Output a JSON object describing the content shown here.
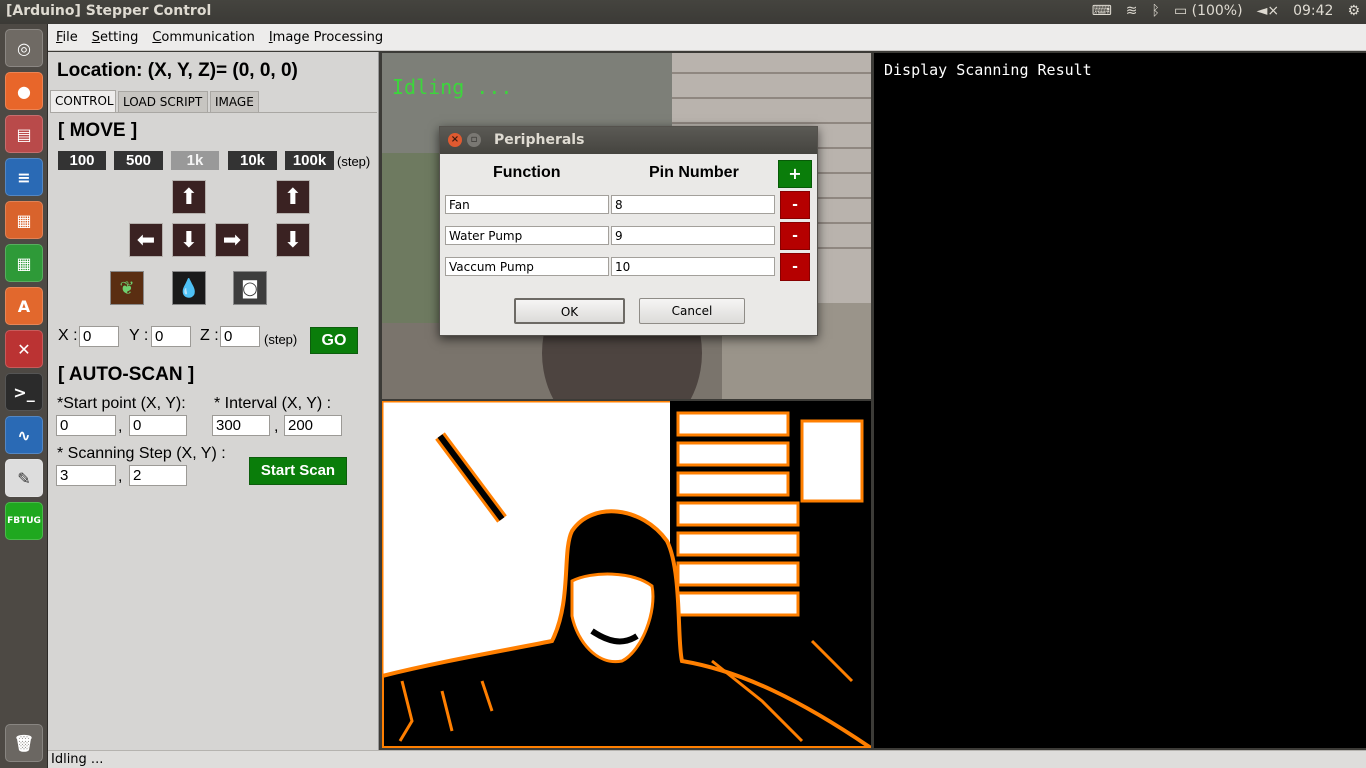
{
  "window": {
    "title": "[Arduino] Stepper Control"
  },
  "tray": {
    "battery": "(100%)",
    "time": "09:42"
  },
  "launcher": {
    "fbtug_label": "FBTUG"
  },
  "menu": [
    "File",
    "Setting",
    "Communication",
    "Image Processing"
  ],
  "location_text": "Location: (X, Y, Z)= (0, 0, 0)",
  "tabs": [
    "CONTROL",
    "LOAD SCRIPT",
    "IMAGE"
  ],
  "move": {
    "header": "[ MOVE ]",
    "steps": [
      "100",
      "500",
      "1k",
      "10k",
      "100k"
    ],
    "selected_step": "1k",
    "step_unit": "(step)"
  },
  "goto": {
    "x_label": "X :",
    "x_value": "0",
    "y_label": "Y :",
    "y_value": "0",
    "z_label": "Z :",
    "z_value": "0",
    "unit": "(step)",
    "go_label": "GO"
  },
  "autoscan": {
    "header": "[ AUTO-SCAN ]",
    "start_label": "*Start point (X, Y):",
    "start_x": "0",
    "start_y": "0",
    "interval_label": "* Interval (X, Y) :",
    "interval_x": "300",
    "interval_y": "200",
    "step_label": "* Scanning Step (X, Y) :",
    "step_x": "3",
    "step_y": "2",
    "comma": ",",
    "start_scan_label": "Start Scan"
  },
  "camera": {
    "overlay_text": "Idling ..."
  },
  "result": {
    "title": "Display Scanning Result"
  },
  "status": "Idling ...",
  "dialog": {
    "title": "Peripherals",
    "col_function": "Function",
    "col_pin": "Pin Number",
    "add_label": "+",
    "remove_label": "-",
    "rows": [
      {
        "function": "Fan",
        "pin": "8"
      },
      {
        "function": "Water Pump",
        "pin": "9"
      },
      {
        "function": "Vaccum Pump",
        "pin": "10"
      }
    ],
    "ok_label": "OK",
    "cancel_label": "Cancel"
  },
  "colors": {
    "go_green": "#0a7d0a",
    "remove_red": "#b50000",
    "overlay_green": "#3cd63c",
    "edge_orange": "#ff7f00"
  }
}
